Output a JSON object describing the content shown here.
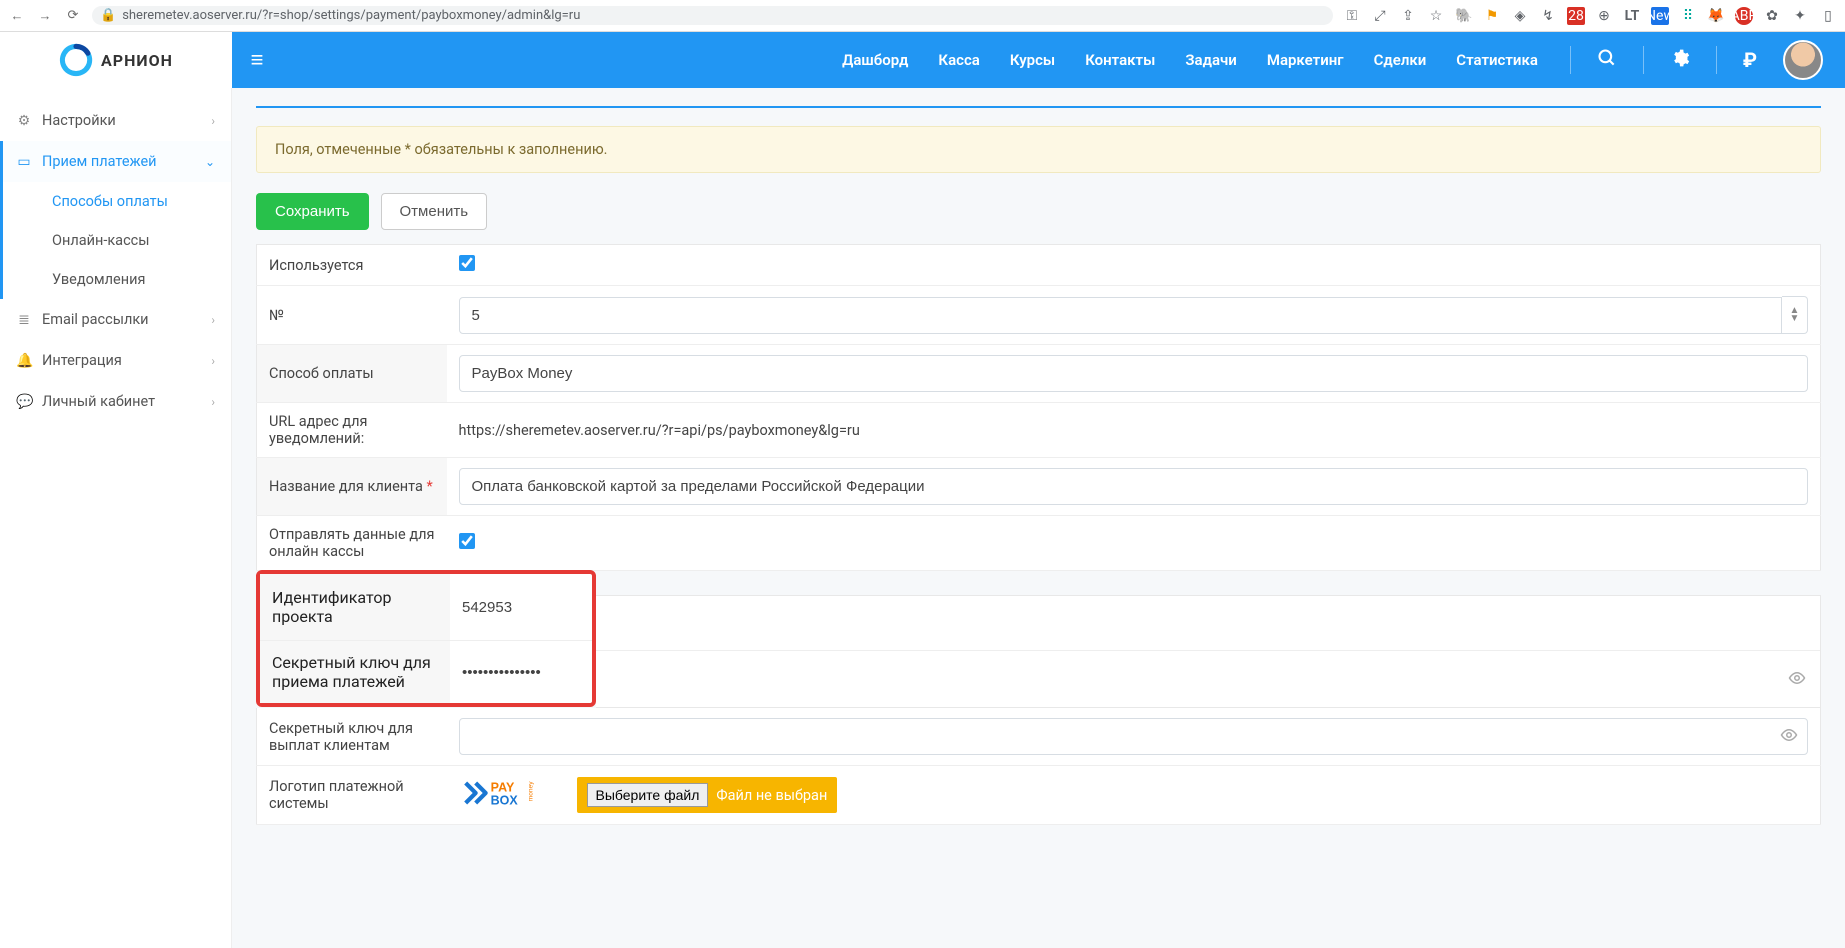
{
  "browser": {
    "url": "sheremetev.aoserver.ru/?r=shop/settings/payment/payboxmoney/admin&lg=ru",
    "ext_labels": {
      "cal": "28",
      "new": "New",
      "lt": "LT",
      "abp": "ABP",
      "abp_badge": "3"
    }
  },
  "header": {
    "logo_text": "АРНИОН",
    "nav": [
      "Дашборд",
      "Касса",
      "Курсы",
      "Контакты",
      "Задачи",
      "Маркетинг",
      "Сделки",
      "Статистика"
    ],
    "currency_symbol": "₽"
  },
  "sidebar": {
    "items": [
      {
        "icon": "gear-icon",
        "label": "Настройки",
        "expandable": true
      },
      {
        "icon": "card-icon",
        "label": "Прием платежей",
        "expandable": true,
        "active": true,
        "children": [
          {
            "label": "Способы оплаты",
            "active": true
          },
          {
            "label": "Онлайн-кассы"
          },
          {
            "label": "Уведомления"
          }
        ]
      },
      {
        "icon": "list-icon",
        "label": "Email рассылки",
        "expandable": true
      },
      {
        "icon": "bell-icon",
        "label": "Интеграция",
        "expandable": true
      },
      {
        "icon": "chat-icon",
        "label": "Личный кабинет",
        "expandable": true
      }
    ]
  },
  "alert": {
    "text": "Поля, отмеченные * обязательны к заполнению."
  },
  "buttons": {
    "save": "Сохранить",
    "cancel": "Отменить"
  },
  "form": {
    "rows": {
      "used": {
        "label": "Используется",
        "checked": true
      },
      "num": {
        "label": "№",
        "value": "5"
      },
      "method": {
        "label": "Способ оплаты",
        "value": "PayBox Money"
      },
      "url": {
        "label": "URL адрес для уведомлений:",
        "value": "https://sheremetev.aoserver.ru/?r=api/ps/payboxmoney&lg=ru"
      },
      "client": {
        "label": "Название для клиента",
        "required": true,
        "value": "Оплата банковской картой за пределами Российской Федерации"
      },
      "kassa": {
        "label": "Отправлять данные для онлайн кассы",
        "checked": true
      },
      "project": {
        "label": "Идентификатор проекта",
        "value": "542953"
      },
      "secret_in": {
        "label": "Секретный ключ для приема платежей",
        "value": "•••••••••••••••"
      },
      "secret_out": {
        "label": "Секретный ключ для выплат клиентам",
        "value": ""
      },
      "logo": {
        "label": "Логотип платежной системы",
        "btn": "Выберите файл",
        "status": "Файл не выбран"
      }
    }
  }
}
